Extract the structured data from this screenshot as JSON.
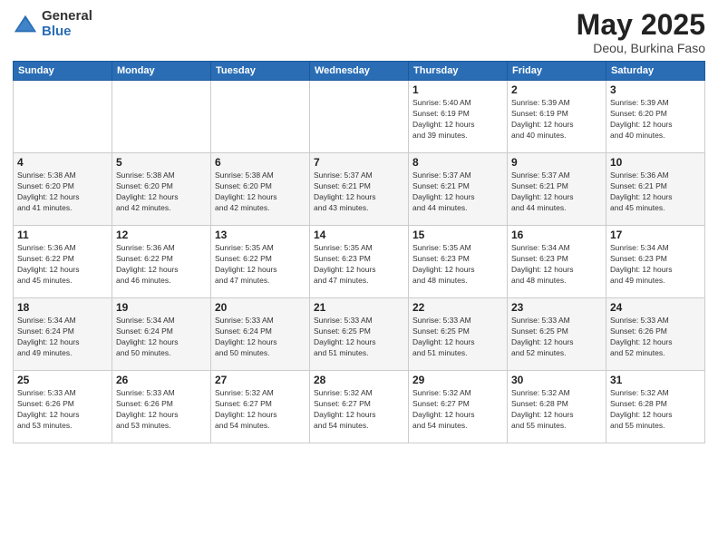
{
  "logo": {
    "general": "General",
    "blue": "Blue"
  },
  "title": "May 2025",
  "subtitle": "Deou, Burkina Faso",
  "days_of_week": [
    "Sunday",
    "Monday",
    "Tuesday",
    "Wednesday",
    "Thursday",
    "Friday",
    "Saturday"
  ],
  "weeks": [
    [
      {
        "day": "",
        "info": ""
      },
      {
        "day": "",
        "info": ""
      },
      {
        "day": "",
        "info": ""
      },
      {
        "day": "",
        "info": ""
      },
      {
        "day": "1",
        "info": "Sunrise: 5:40 AM\nSunset: 6:19 PM\nDaylight: 12 hours\nand 39 minutes."
      },
      {
        "day": "2",
        "info": "Sunrise: 5:39 AM\nSunset: 6:19 PM\nDaylight: 12 hours\nand 40 minutes."
      },
      {
        "day": "3",
        "info": "Sunrise: 5:39 AM\nSunset: 6:20 PM\nDaylight: 12 hours\nand 40 minutes."
      }
    ],
    [
      {
        "day": "4",
        "info": "Sunrise: 5:38 AM\nSunset: 6:20 PM\nDaylight: 12 hours\nand 41 minutes."
      },
      {
        "day": "5",
        "info": "Sunrise: 5:38 AM\nSunset: 6:20 PM\nDaylight: 12 hours\nand 42 minutes."
      },
      {
        "day": "6",
        "info": "Sunrise: 5:38 AM\nSunset: 6:20 PM\nDaylight: 12 hours\nand 42 minutes."
      },
      {
        "day": "7",
        "info": "Sunrise: 5:37 AM\nSunset: 6:21 PM\nDaylight: 12 hours\nand 43 minutes."
      },
      {
        "day": "8",
        "info": "Sunrise: 5:37 AM\nSunset: 6:21 PM\nDaylight: 12 hours\nand 44 minutes."
      },
      {
        "day": "9",
        "info": "Sunrise: 5:37 AM\nSunset: 6:21 PM\nDaylight: 12 hours\nand 44 minutes."
      },
      {
        "day": "10",
        "info": "Sunrise: 5:36 AM\nSunset: 6:21 PM\nDaylight: 12 hours\nand 45 minutes."
      }
    ],
    [
      {
        "day": "11",
        "info": "Sunrise: 5:36 AM\nSunset: 6:22 PM\nDaylight: 12 hours\nand 45 minutes."
      },
      {
        "day": "12",
        "info": "Sunrise: 5:36 AM\nSunset: 6:22 PM\nDaylight: 12 hours\nand 46 minutes."
      },
      {
        "day": "13",
        "info": "Sunrise: 5:35 AM\nSunset: 6:22 PM\nDaylight: 12 hours\nand 47 minutes."
      },
      {
        "day": "14",
        "info": "Sunrise: 5:35 AM\nSunset: 6:23 PM\nDaylight: 12 hours\nand 47 minutes."
      },
      {
        "day": "15",
        "info": "Sunrise: 5:35 AM\nSunset: 6:23 PM\nDaylight: 12 hours\nand 48 minutes."
      },
      {
        "day": "16",
        "info": "Sunrise: 5:34 AM\nSunset: 6:23 PM\nDaylight: 12 hours\nand 48 minutes."
      },
      {
        "day": "17",
        "info": "Sunrise: 5:34 AM\nSunset: 6:23 PM\nDaylight: 12 hours\nand 49 minutes."
      }
    ],
    [
      {
        "day": "18",
        "info": "Sunrise: 5:34 AM\nSunset: 6:24 PM\nDaylight: 12 hours\nand 49 minutes."
      },
      {
        "day": "19",
        "info": "Sunrise: 5:34 AM\nSunset: 6:24 PM\nDaylight: 12 hours\nand 50 minutes."
      },
      {
        "day": "20",
        "info": "Sunrise: 5:33 AM\nSunset: 6:24 PM\nDaylight: 12 hours\nand 50 minutes."
      },
      {
        "day": "21",
        "info": "Sunrise: 5:33 AM\nSunset: 6:25 PM\nDaylight: 12 hours\nand 51 minutes."
      },
      {
        "day": "22",
        "info": "Sunrise: 5:33 AM\nSunset: 6:25 PM\nDaylight: 12 hours\nand 51 minutes."
      },
      {
        "day": "23",
        "info": "Sunrise: 5:33 AM\nSunset: 6:25 PM\nDaylight: 12 hours\nand 52 minutes."
      },
      {
        "day": "24",
        "info": "Sunrise: 5:33 AM\nSunset: 6:26 PM\nDaylight: 12 hours\nand 52 minutes."
      }
    ],
    [
      {
        "day": "25",
        "info": "Sunrise: 5:33 AM\nSunset: 6:26 PM\nDaylight: 12 hours\nand 53 minutes."
      },
      {
        "day": "26",
        "info": "Sunrise: 5:33 AM\nSunset: 6:26 PM\nDaylight: 12 hours\nand 53 minutes."
      },
      {
        "day": "27",
        "info": "Sunrise: 5:32 AM\nSunset: 6:27 PM\nDaylight: 12 hours\nand 54 minutes."
      },
      {
        "day": "28",
        "info": "Sunrise: 5:32 AM\nSunset: 6:27 PM\nDaylight: 12 hours\nand 54 minutes."
      },
      {
        "day": "29",
        "info": "Sunrise: 5:32 AM\nSunset: 6:27 PM\nDaylight: 12 hours\nand 54 minutes."
      },
      {
        "day": "30",
        "info": "Sunrise: 5:32 AM\nSunset: 6:28 PM\nDaylight: 12 hours\nand 55 minutes."
      },
      {
        "day": "31",
        "info": "Sunrise: 5:32 AM\nSunset: 6:28 PM\nDaylight: 12 hours\nand 55 minutes."
      }
    ]
  ]
}
